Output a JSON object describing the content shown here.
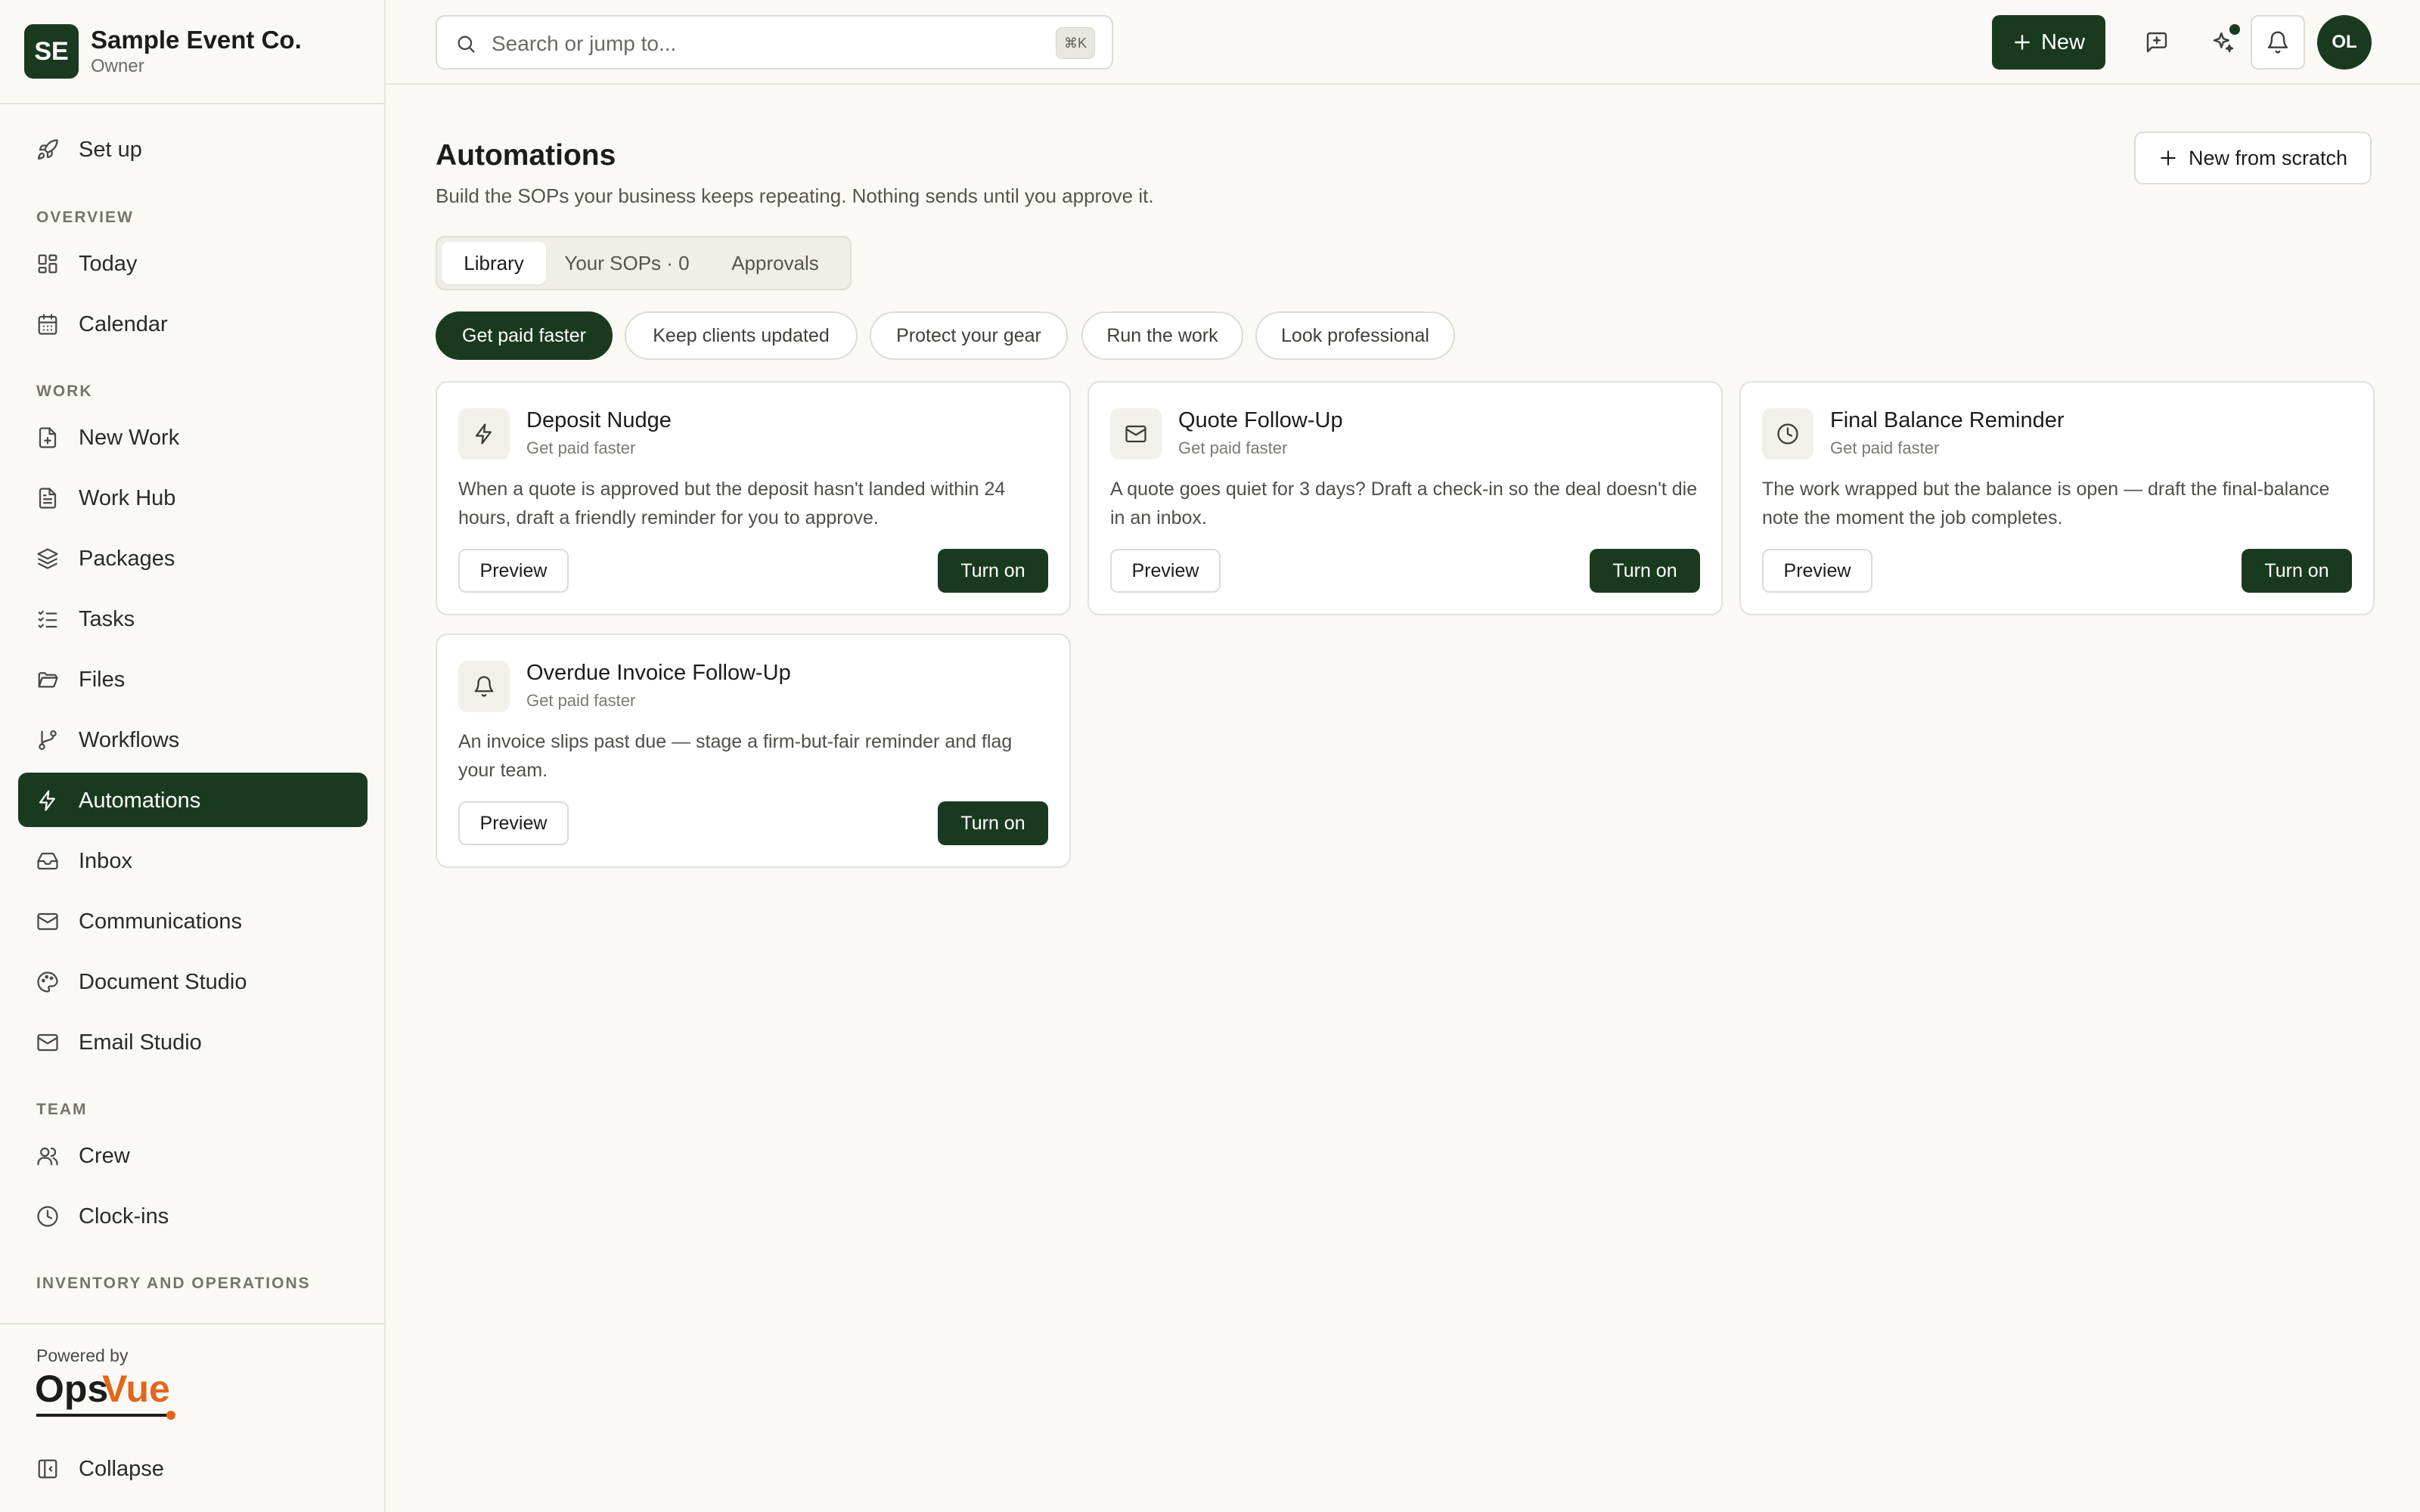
{
  "org": {
    "initials": "SE",
    "name": "Sample Event Co.",
    "role": "Owner"
  },
  "nav": {
    "setup": "Set up",
    "sections": {
      "overview": "OVERVIEW",
      "work": "WORK",
      "team": "TEAM",
      "inventory": "INVENTORY AND OPERATIONS"
    },
    "items": {
      "today": "Today",
      "calendar": "Calendar",
      "new_work": "New Work",
      "work_hub": "Work Hub",
      "packages": "Packages",
      "tasks": "Tasks",
      "files": "Files",
      "workflows": "Workflows",
      "automations": "Automations",
      "inbox": "Inbox",
      "communications": "Communications",
      "document_studio": "Document Studio",
      "email_studio": "Email Studio",
      "crew": "Crew",
      "clock_ins": "Clock-ins"
    },
    "active": "automations"
  },
  "footer": {
    "powered_by": "Powered by",
    "brand_a": "Ops",
    "brand_b": "Vue",
    "collapse": "Collapse"
  },
  "topbar": {
    "search_placeholder": "Search or jump to...",
    "search_shortcut": "⌘K",
    "new_label": "New",
    "user_initials": "OL"
  },
  "page": {
    "title": "Automations",
    "subtitle": "Build the SOPs your business keeps repeating. Nothing sends until you approve it.",
    "new_from_scratch": "New from scratch"
  },
  "tabs": [
    "Library",
    "Your SOPs · 0",
    "Approvals"
  ],
  "filters": [
    "Get paid faster",
    "Keep clients updated",
    "Protect your gear",
    "Run the work",
    "Look professional"
  ],
  "cards": [
    {
      "icon": "lightning-icon",
      "title": "Deposit Nudge",
      "category": "Get paid faster",
      "description": "When a quote is approved but the deposit hasn't landed within 24 hours, draft a friendly reminder for you to approve.",
      "preview": "Preview",
      "turn_on": "Turn on"
    },
    {
      "icon": "mail-icon",
      "title": "Quote Follow-Up",
      "category": "Get paid faster",
      "description": "A quote goes quiet for 3 days? Draft a check-in so the deal doesn't die in an inbox.",
      "preview": "Preview",
      "turn_on": "Turn on"
    },
    {
      "icon": "clock-icon",
      "title": "Final Balance Reminder",
      "category": "Get paid faster",
      "description": "The work wrapped but the balance is open — draft the final-balance note the moment the job completes.",
      "preview": "Preview",
      "turn_on": "Turn on"
    },
    {
      "icon": "bell-icon",
      "title": "Overdue Invoice Follow-Up",
      "category": "Get paid faster",
      "description": "An invoice slips past due — stage a firm-but-fair reminder and flag your team.",
      "preview": "Preview",
      "turn_on": "Turn on"
    }
  ],
  "colors": {
    "accent": "#1a3a1f",
    "brand_orange": "#e2661d",
    "background": "#faf9f6"
  }
}
